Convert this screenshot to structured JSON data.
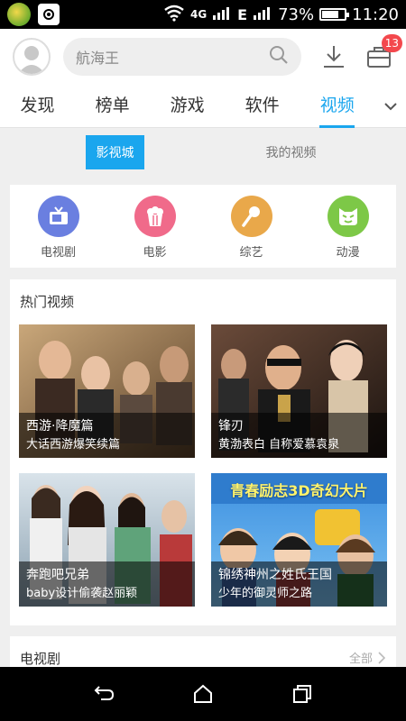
{
  "status_bar": {
    "network_type": "4G",
    "data_label": "E",
    "battery": "73%",
    "time": "11:20"
  },
  "header": {
    "search_placeholder": "航海王",
    "notification_count": "13"
  },
  "tabs": [
    {
      "label": "发现"
    },
    {
      "label": "榜单"
    },
    {
      "label": "游戏"
    },
    {
      "label": "软件"
    },
    {
      "label": "视频"
    }
  ],
  "active_tab": "视频",
  "segment": {
    "active": "影视城",
    "other": "我的视频"
  },
  "categories": [
    {
      "label": "电视剧",
      "color": "#6a7fe0",
      "icon": "tv-icon"
    },
    {
      "label": "电影",
      "color": "#f06a8a",
      "icon": "popcorn-icon"
    },
    {
      "label": "综艺",
      "color": "#e9a84a",
      "icon": "microphone-icon"
    },
    {
      "label": "动漫",
      "color": "#7dc847",
      "icon": "cartoon-face-icon"
    }
  ],
  "hot_videos": {
    "title": "热门视频",
    "items": [
      {
        "title": "西游·降魔篇",
        "subtitle": "大话西游爆笑续篇"
      },
      {
        "title": "锋刃",
        "subtitle": "黄渤表白 自称爱慕袁泉"
      },
      {
        "title": "奔跑吧兄弟",
        "subtitle": "baby设计偷袭赵丽颖"
      },
      {
        "title": "锦绣神州之姓氏王国",
        "subtitle": "少年的御灵师之路",
        "banner": "青春励志3D奇幻大片"
      }
    ]
  },
  "tv_section": {
    "title": "电视剧",
    "more_label": "全部"
  }
}
